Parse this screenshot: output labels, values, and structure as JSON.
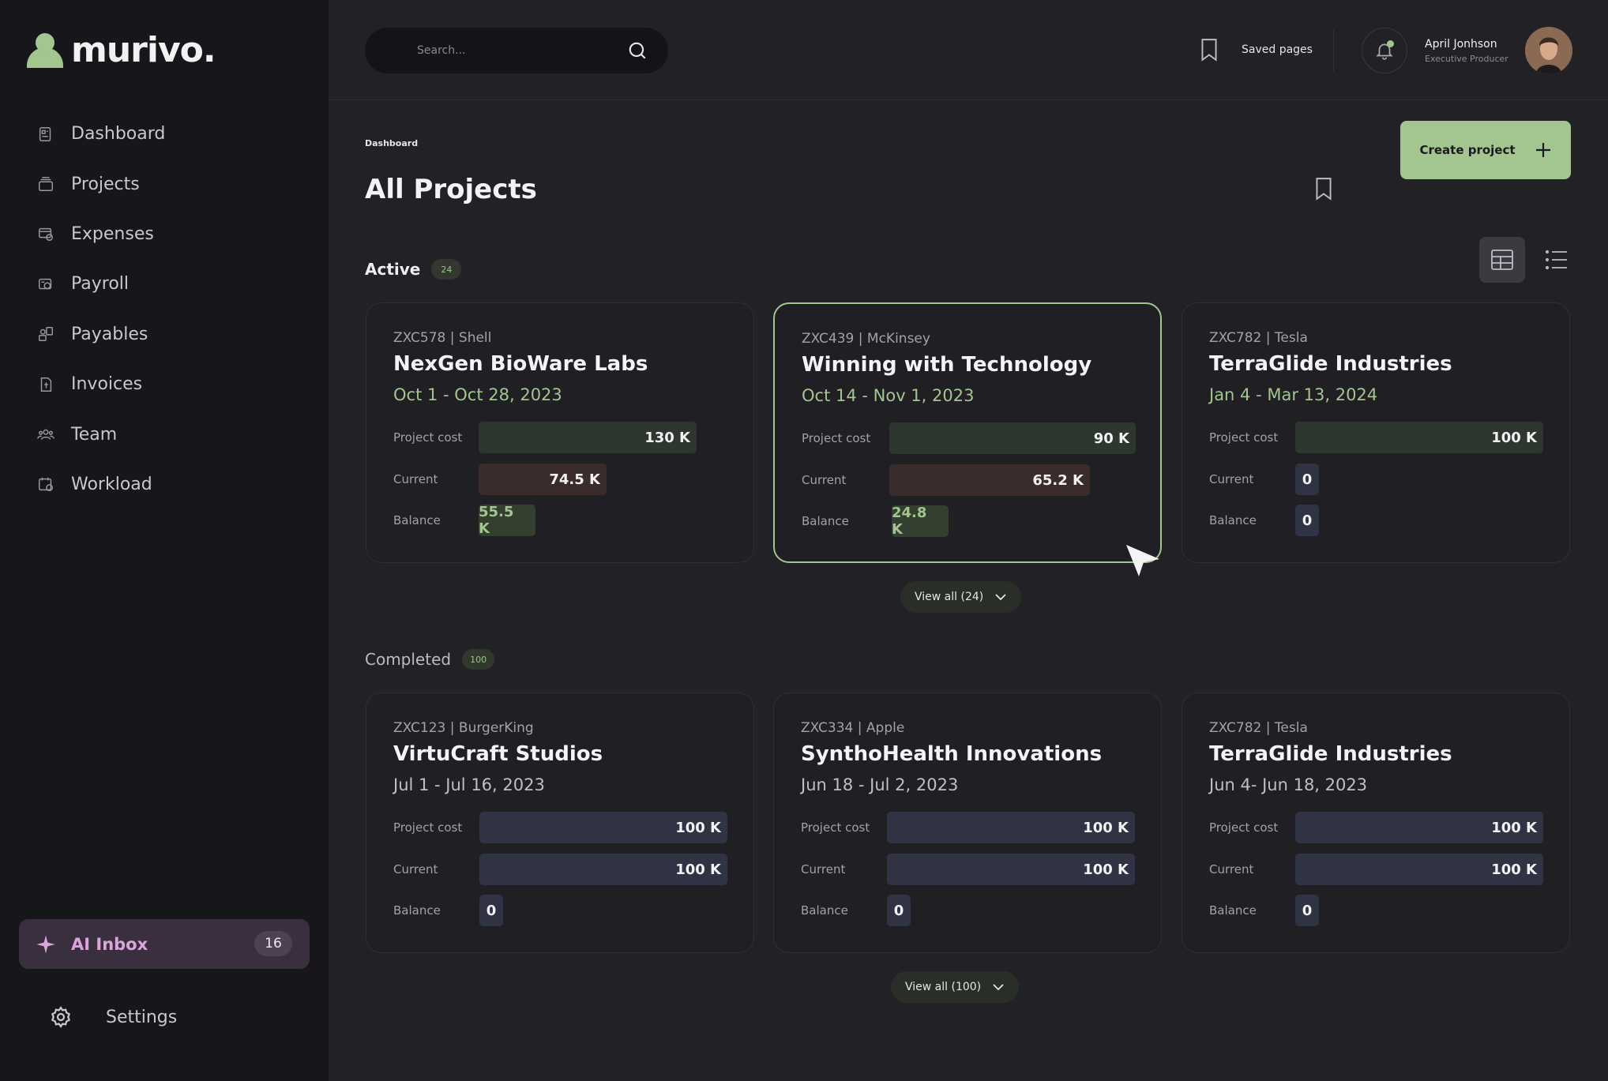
{
  "brand": {
    "name": "murivo."
  },
  "sidebar": {
    "items": [
      {
        "label": "Dashboard",
        "icon": "dashboard-icon"
      },
      {
        "label": "Projects",
        "icon": "projects-icon"
      },
      {
        "label": "Expenses",
        "icon": "expenses-icon"
      },
      {
        "label": "Payroll",
        "icon": "payroll-icon"
      },
      {
        "label": "Payables",
        "icon": "payables-icon"
      },
      {
        "label": "Invoices",
        "icon": "invoices-icon"
      },
      {
        "label": "Team",
        "icon": "team-icon"
      },
      {
        "label": "Workload",
        "icon": "workload-icon"
      }
    ],
    "ai_inbox": {
      "label": "AI Inbox",
      "count": "16"
    },
    "settings_label": "Settings"
  },
  "header": {
    "search_placeholder": "Search...",
    "saved_pages_label": "Saved pages",
    "user": {
      "name": "April Jonhson",
      "role": "Executive Producer"
    }
  },
  "page": {
    "breadcrumb": "Dashboard",
    "title": "All Projects",
    "create_label": "Create project"
  },
  "active": {
    "title": "Active",
    "count": "24",
    "view_all_label": "View all (24)",
    "cards": [
      {
        "id": "ZXC578 | Shell",
        "name": "NexGen BioWare Labs",
        "dates": "Oct 1 - Oct 28, 2023",
        "project_cost": "130 K",
        "current": "74.5 K",
        "balance": "55.5 K",
        "cost_value": 130,
        "current_value": 74.5,
        "balance_value": 55.5
      },
      {
        "id": "ZXC439 | McKinsey",
        "name": "Winning with Technology",
        "dates": "Oct 14 - Nov 1, 2023",
        "project_cost": "90 K",
        "current": "65.2 K",
        "balance": "24.8 K",
        "cost_value": 90,
        "current_value": 65.2,
        "balance_value": 24.8
      },
      {
        "id": "ZXC782 | Tesla",
        "name": "TerraGlide Industries",
        "dates": "Jan 4 - Mar 13, 2024",
        "project_cost": "100 K",
        "current": "0",
        "balance": "0",
        "cost_value": 100,
        "current_value": 0,
        "balance_value": 0
      }
    ]
  },
  "completed": {
    "title": "Completed",
    "count": "100",
    "view_all_label": "View all (100)",
    "cards": [
      {
        "id": "ZXC123 | BurgerKing",
        "name": "VirtuCraft Studios",
        "dates": "Jul 1 - Jul 16, 2023",
        "project_cost": "100 K",
        "current": "100 K",
        "balance": "0"
      },
      {
        "id": "ZXC334 | Apple",
        "name": "SynthoHealth Innovations",
        "dates": "Jun 18 - Jul 2, 2023",
        "project_cost": "100 K",
        "current": "100 K",
        "balance": "0"
      },
      {
        "id": "ZXC782 | Tesla",
        "name": "TerraGlide Industries",
        "dates": "Jun 4- Jun 18, 2023",
        "project_cost": "100 K",
        "current": "100 K",
        "balance": "0"
      }
    ]
  },
  "labels": {
    "project_cost": "Project cost",
    "current": "Current",
    "balance": "Balance"
  },
  "colors": {
    "accent": "#a3c58f",
    "ai_accent": "#d8a6dc",
    "background": "#222126",
    "sidebar": "#17161a"
  }
}
